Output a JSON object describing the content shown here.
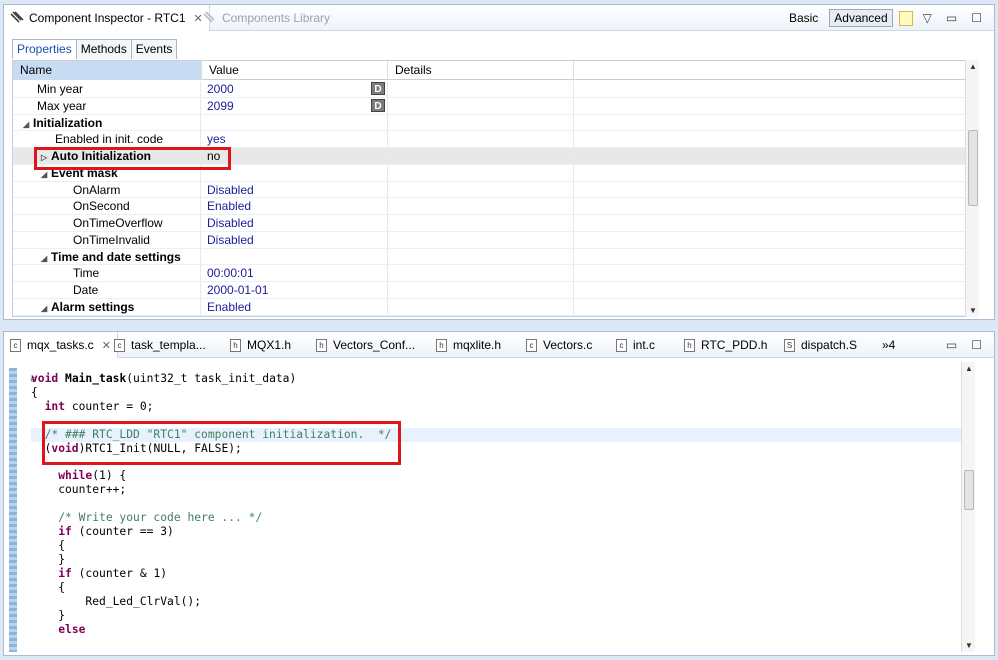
{
  "inspector": {
    "tab_title": "Component Inspector - RTC1",
    "library_tab": "Components Library",
    "mode_basic": "Basic",
    "mode_advanced": "Advanced",
    "subtabs": [
      "Properties",
      "Methods",
      "Events"
    ],
    "columns": [
      "Name",
      "Value",
      "Details"
    ],
    "rows": [
      {
        "name": "Min year",
        "value": "2000",
        "d": "D"
      },
      {
        "name": "Max year",
        "value": "2099",
        "d": "D"
      },
      {
        "name": "Initialization",
        "value": ""
      },
      {
        "name": "Enabled in init. code",
        "value": "yes"
      },
      {
        "name": "Auto Initialization",
        "value": "no"
      },
      {
        "name": "Event mask",
        "value": ""
      },
      {
        "name": "OnAlarm",
        "value": "Disabled"
      },
      {
        "name": "OnSecond",
        "value": "Enabled"
      },
      {
        "name": "OnTimeOverflow",
        "value": "Disabled"
      },
      {
        "name": "OnTimeInvalid",
        "value": "Disabled"
      },
      {
        "name": "Time and date settings",
        "value": ""
      },
      {
        "name": "Time",
        "value": "00:00:01"
      },
      {
        "name": "Date",
        "value": "2000-01-01"
      },
      {
        "name": "Alarm settings",
        "value": "Enabled"
      }
    ]
  },
  "editor": {
    "tabs": [
      "mqx_tasks.c",
      "task_templa...",
      "MQX1.h",
      "Vectors_Conf...",
      "mqxlite.h",
      "Vectors.c",
      "int.c",
      "RTC_PDD.h",
      "dispatch.S"
    ],
    "tab_icons": [
      "c",
      "c",
      "h",
      "h",
      "h",
      "c",
      "c",
      "h",
      "S"
    ],
    "overflow": "»4",
    "code": [
      {
        "text": "void Main_task(uint32_t task_init_data)",
        "html": "<span class=\"kw\">void</span> <b>Main_task</b>(uint32_t task_init_data)"
      },
      {
        "text": "{",
        "html": "{"
      },
      {
        "text": "  int counter = 0;",
        "html": "  <span class=\"kw\">int</span> counter = 0;"
      },
      {
        "text": "",
        "html": ""
      },
      {
        "text": "  /* ### RTC_LDD \"RTC1\" component initialization.  */",
        "html": "  <span class=\"cm\">/* ### RTC_LDD \"RTC1\" component initialization.  */</span>",
        "current": true
      },
      {
        "text": "  (void)RTC1_Init(NULL, FALSE);",
        "html": "  (<span class=\"kw\">void</span>)RTC1_Init(NULL, FALSE);"
      },
      {
        "text": "",
        "html": ""
      },
      {
        "text": "    while(1) {",
        "html": "    <span class=\"kw\">while</span>(1) {"
      },
      {
        "text": "    counter++;",
        "html": "    counter++;"
      },
      {
        "text": "",
        "html": ""
      },
      {
        "text": "    /* Write your code here ... */",
        "html": "    <span class=\"cm\">/* Write your code here ... */</span>"
      },
      {
        "text": "    if (counter == 3)",
        "html": "    <span class=\"kw\">if</span> (counter == 3)"
      },
      {
        "text": "    {",
        "html": "    {"
      },
      {
        "text": "    }",
        "html": "    }"
      },
      {
        "text": "    if (counter & 1)",
        "html": "    <span class=\"kw\">if</span> (counter &amp; 1)"
      },
      {
        "text": "    {",
        "html": "    {"
      },
      {
        "text": "        Red_Led_ClrVal();",
        "html": "        Red_Led_ClrVal();"
      },
      {
        "text": "    }",
        "html": "    }"
      },
      {
        "text": "    else",
        "html": "    <span class=\"kw\">else</span>"
      }
    ]
  },
  "colors": {
    "highlight_box": "#e0151b",
    "keyword": "#7f0055",
    "comment": "#3f7f5f"
  }
}
